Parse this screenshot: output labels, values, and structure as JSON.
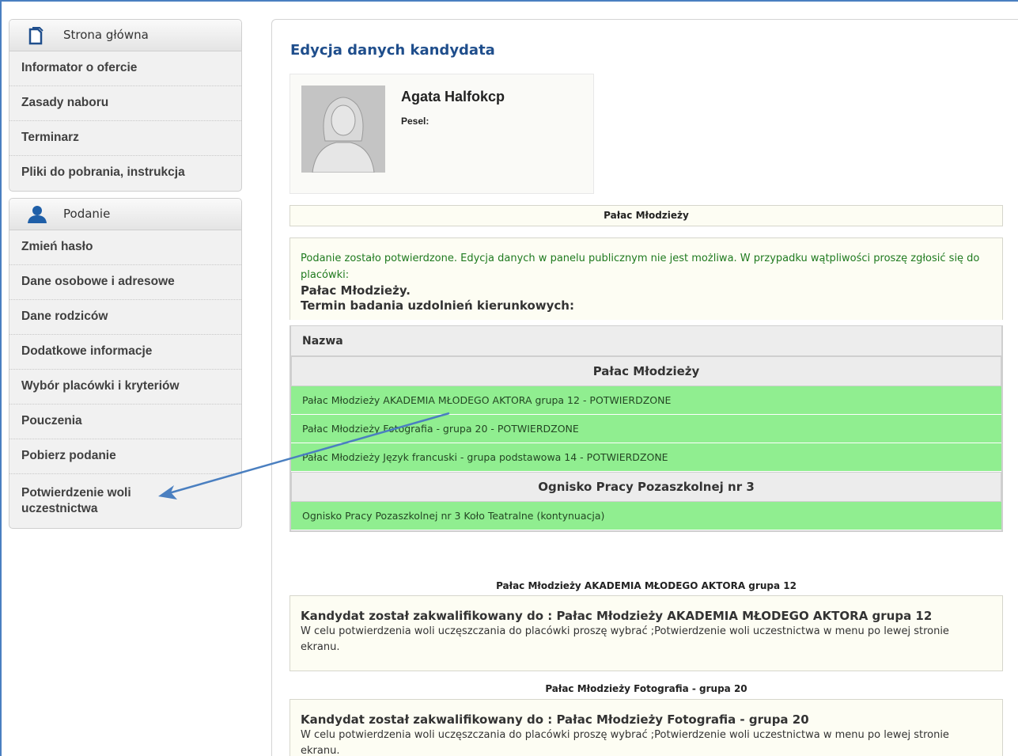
{
  "sidebar": {
    "home_label": "Strona główna",
    "info_items": [
      {
        "label": "Informator o ofercie"
      },
      {
        "label": "Zasady naboru"
      },
      {
        "label": "Terminarz"
      },
      {
        "label": "Pliki do pobrania, instrukcja"
      }
    ],
    "application_label": "Podanie",
    "app_items": [
      {
        "label": "Zmień hasło"
      },
      {
        "label": "Dane osobowe i adresowe"
      },
      {
        "label": "Dane rodziców"
      },
      {
        "label": "Dodatkowe informacje"
      },
      {
        "label": "Wybór placówki i kryteriów"
      },
      {
        "label": "Pouczenia"
      },
      {
        "label": "Pobierz podanie"
      },
      {
        "label": "Potwierdzenie woli uczestnictwa"
      }
    ]
  },
  "main": {
    "title": "Edycja danych kandydata",
    "candidate": {
      "name": "Agata Halfokcp",
      "pesel_label": "Pesel:"
    },
    "school_bar": "Pałac Młodzieży",
    "notice": {
      "text": "Podanie zostało potwierdzone. Edycja danych w panelu publicznym nie jest możliwa. W przypadku wątpliwości proszę zgłosić się do placówki:",
      "school": "Pałac Młodzieży.",
      "exam_term": "Termin badania uzdolnień kierunkowych:"
    },
    "table": {
      "header": "Nazwa",
      "groups": [
        {
          "name": "Pałac Młodzieży",
          "rows": [
            "Pałac Młodzieży AKADEMIA MŁODEGO AKTORA grupa 12 - POTWIERDZONE",
            "Pałac Młodzieży Fotografia - grupa 20 - POTWIERDZONE",
            "Pałac Młodzieży Język francuski - grupa podstawowa 14 - POTWIERDZONE"
          ]
        },
        {
          "name": "Ognisko Pracy Pozaszkolnej nr 3",
          "rows": [
            "Ognisko Pracy Pozaszkolnej nr 3 Koło Teatralne (kontynuacja)"
          ]
        }
      ]
    },
    "qualifications": [
      {
        "title": "Pałac Młodzieży AKADEMIA MŁODEGO AKTORA grupa 12",
        "heading": "Kandydat został zakwalifikowany do : Pałac Młodzieży AKADEMIA MŁODEGO AKTORA grupa 12",
        "text": "W celu potwierdzenia woli uczęszczania do placówki proszę wybrać ;Potwierdzenie woli uczestnictwa w menu po lewej stronie ekranu."
      },
      {
        "title": "Pałac Młodzieży Fotografia - grupa 20",
        "heading": "Kandydat został zakwalifikowany do : Pałac Młodzieży Fotografia - grupa 20",
        "text": "W celu potwierdzenia woli uczęszczania do placówki proszę wybrać ;Potwierdzenie woli uczestnictwa w menu po lewej stronie ekranu."
      }
    ]
  },
  "colors": {
    "accent_blue": "#1f4e8c",
    "confirmed_green": "#90ee90",
    "notice_green": "#1f7a1f",
    "arrow": "#4a7fc0"
  }
}
